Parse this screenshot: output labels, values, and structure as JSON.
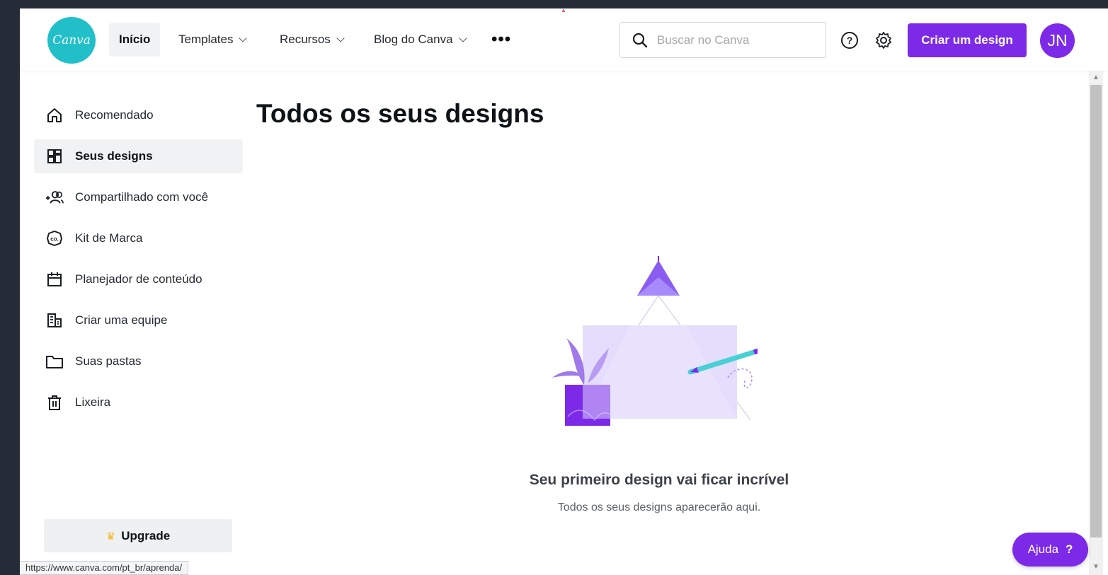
{
  "logo": {
    "text": "Canva"
  },
  "nav": {
    "items": [
      {
        "label": "Início",
        "active": true,
        "has_dropdown": false
      },
      {
        "label": "Templates",
        "active": false,
        "has_dropdown": true
      },
      {
        "label": "Recursos",
        "active": false,
        "has_dropdown": true
      },
      {
        "label": "Blog do Canva",
        "active": false,
        "has_dropdown": true
      }
    ],
    "more_label": "•••"
  },
  "search": {
    "placeholder": "Buscar no Canva",
    "value": "",
    "icon": "search-icon"
  },
  "header_icons": [
    "help-icon",
    "gear-icon"
  ],
  "create_button": {
    "label": "Criar um design"
  },
  "avatar": {
    "initials": "JN"
  },
  "sidebar": {
    "items": [
      {
        "label": "Recomendado",
        "icon": "home-icon",
        "active": false
      },
      {
        "label": "Seus designs",
        "icon": "grid-icon",
        "active": true
      },
      {
        "label": "Compartilhado com você",
        "icon": "shared-users-icon",
        "active": false
      },
      {
        "label": "Kit de Marca",
        "icon": "brand-kit-icon",
        "active": false
      },
      {
        "label": "Planejador de conteúdo",
        "icon": "calendar-icon",
        "active": false
      },
      {
        "label": "Criar uma equipe",
        "icon": "building-icon",
        "active": false
      },
      {
        "label": "Suas pastas",
        "icon": "folder-icon",
        "active": false
      },
      {
        "label": "Lixeira",
        "icon": "trash-icon",
        "active": false
      }
    ],
    "upgrade_label": "Upgrade",
    "upgrade_icon": "crown-icon"
  },
  "main": {
    "title": "Todos os seus designs",
    "empty_title": "Seu primeiro design vai ficar incrível",
    "empty_subtitle": "Todos os seus designs aparecerão aqui."
  },
  "help_button": {
    "label": "Ajuda",
    "mark": "?"
  },
  "status_bar": {
    "url": "https://www.canva.com/pt_br/aprenda/"
  },
  "colors": {
    "brand_purple": "#7d2ae8",
    "logo_teal": "#21c0c9",
    "active_bg": "#f1f2f4",
    "page_bg": "#262b38"
  }
}
